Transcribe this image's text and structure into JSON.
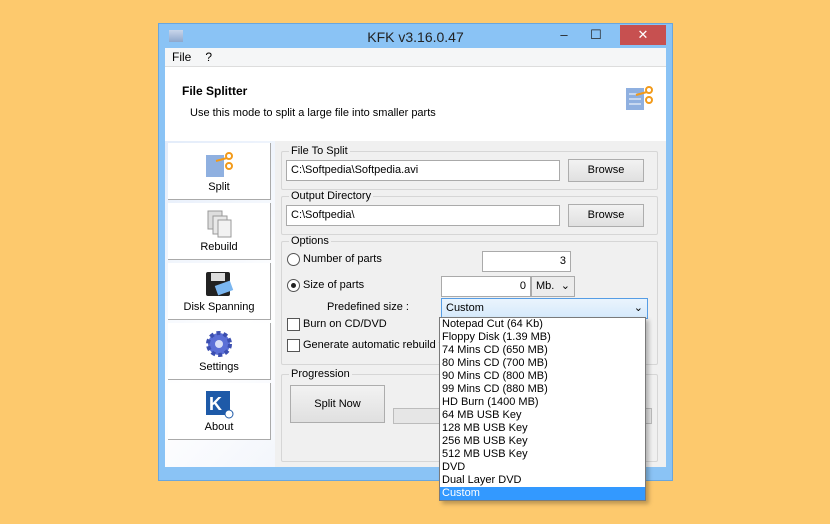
{
  "window": {
    "title": "KFK v3.16.0.47",
    "minimize": "‒",
    "maximize": "☐",
    "close": "✕"
  },
  "menu": [
    "File",
    "?"
  ],
  "header": {
    "title": "File Splitter",
    "description": "Use this mode to split a large file into smaller parts"
  },
  "sidebar": {
    "items": [
      {
        "label": "Split",
        "icon": "scissors-file-icon"
      },
      {
        "label": "Rebuild",
        "icon": "documents-icon"
      },
      {
        "label": "Disk Spanning",
        "icon": "floppy-disk-icon"
      },
      {
        "label": "Settings",
        "icon": "gear-icon"
      },
      {
        "label": "About",
        "icon": "kc-logo-icon"
      }
    ]
  },
  "file_to_split": {
    "legend": "File To Split",
    "value": "C:\\Softpedia\\Softpedia.avi",
    "browse": "Browse"
  },
  "output_dir": {
    "legend": "Output Directory",
    "value": "C:\\Softpedia\\",
    "browse": "Browse"
  },
  "options": {
    "legend": "Options",
    "number_of_parts_label": "Number of parts",
    "number_of_parts": "3",
    "size_of_parts_label": "Size of parts",
    "size_of_parts": "0",
    "unit": "Mb.",
    "predefined_label": "Predefined size :",
    "predefined_value": "Custom",
    "burn_label": "Burn on CD/DVD",
    "rebuild_label": "Generate automatic rebuild fil",
    "selected_mode": "size_of_parts"
  },
  "progression": {
    "legend": "Progression",
    "split_now": "Split Now"
  },
  "dropdown_options": [
    "Notepad Cut (64 Kb)",
    "Floppy Disk (1.39 MB)",
    "74 Mins CD (650 MB)",
    "80 Mins CD (700 MB)",
    "90 Mins CD (800 MB)",
    "99 Mins CD (880 MB)",
    "HD Burn (1400 MB)",
    "64 MB USB Key",
    "128 MB USB Key",
    "256 MB USB Key",
    "512 MB USB Key",
    "DVD",
    "Dual Layer DVD",
    "Custom"
  ],
  "colors": {
    "background": "#fdc96d",
    "titlebar": "#8ac3f5",
    "close": "#c75050",
    "selection": "#3399ff"
  }
}
